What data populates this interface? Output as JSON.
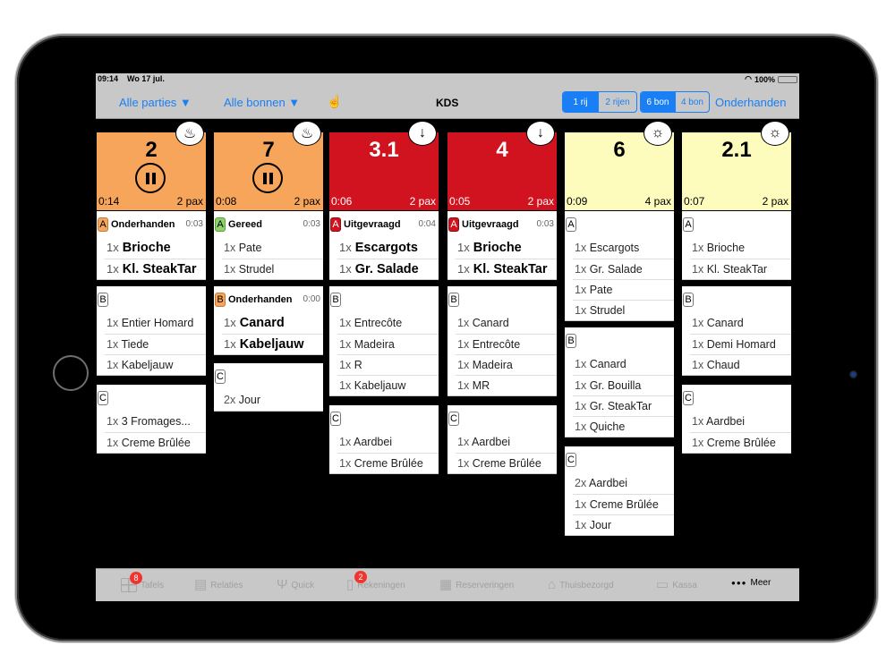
{
  "status_bar": {
    "time": "09:14",
    "date": "Wo 17 jul.",
    "battery": "100%"
  },
  "navbar": {
    "filter_parties": "Alle parties ▼",
    "filter_bonnen": "Alle bonnen ▼",
    "title": "KDS",
    "rows_segment": [
      "1 rij",
      "2 rijen"
    ],
    "rows_selected": "1 rij",
    "bon_segment": [
      "6 bon",
      "4 bon"
    ],
    "bon_selected": "6 bon",
    "right_link": "Onderhanden"
  },
  "colors": {
    "accent": "#1a7ff5",
    "orange": "#f6a55b",
    "red": "#d0131f",
    "yellow": "#fdfcbd",
    "status_green": "#8ed16b"
  },
  "tickets": [
    {
      "table": "2",
      "elapsed": "0:14",
      "pax": "2 pax",
      "color": "orange",
      "paused": true,
      "badge_icon": "steam-icon",
      "badge_glyph": "♨",
      "courses": [
        {
          "letter": "A",
          "status": "Onderhanden",
          "time": "0:03",
          "letter_color": "orange",
          "items": [
            {
              "qty": "1x",
              "name": "Brioche",
              "big": true
            },
            {
              "qty": "1x",
              "name": "Kl. SteakTar",
              "big": true
            }
          ]
        },
        {
          "letter": "B",
          "status": "",
          "time": "",
          "letter_color": "",
          "items": [
            {
              "qty": "1x",
              "name": "Entier Homard"
            },
            {
              "qty": "1x",
              "name": "Tiede"
            },
            {
              "qty": "1x",
              "name": "Kabeljauw"
            }
          ]
        },
        {
          "letter": "C",
          "status": "",
          "time": "",
          "letter_color": "",
          "items": [
            {
              "qty": "1x",
              "name": "3 Fromages..."
            },
            {
              "qty": "1x",
              "name": "Creme Brûlée"
            }
          ]
        }
      ]
    },
    {
      "table": "7",
      "elapsed": "0:08",
      "pax": "2 pax",
      "color": "orange",
      "paused": true,
      "badge_icon": "steam-icon",
      "badge_glyph": "♨",
      "courses": [
        {
          "letter": "A",
          "status": "Gereed",
          "time": "0:03",
          "letter_color": "green",
          "items": [
            {
              "qty": "1x",
              "name": "Pate"
            },
            {
              "qty": "1x",
              "name": "Strudel"
            }
          ]
        },
        {
          "letter": "B",
          "status": "Onderhanden",
          "time": "0:00",
          "letter_color": "orange",
          "items": [
            {
              "qty": "1x",
              "name": "Canard",
              "big": true
            },
            {
              "qty": "1x",
              "name": "Kabeljauw",
              "big": true
            }
          ]
        },
        {
          "letter": "C",
          "status": "",
          "time": "",
          "letter_color": "",
          "items": [
            {
              "qty": "2x",
              "name": "Jour"
            }
          ]
        }
      ]
    },
    {
      "table": "3.1",
      "elapsed": "0:06",
      "pax": "2 pax",
      "color": "red",
      "paused": false,
      "badge_icon": "arrow-down-icon",
      "badge_glyph": "↓",
      "courses": [
        {
          "letter": "A",
          "status": "Uitgevraagd",
          "time": "0:04",
          "letter_color": "red",
          "items": [
            {
              "qty": "1x",
              "name": "Escargots",
              "big": true
            },
            {
              "qty": "1x",
              "name": "Gr. Salade",
              "big": true
            }
          ]
        },
        {
          "letter": "B",
          "status": "",
          "time": "",
          "letter_color": "",
          "items": [
            {
              "qty": "1x",
              "name": "Entrecôte"
            },
            {
              "qty": "1x",
              "name": "Madeira"
            },
            {
              "qty": "1x",
              "name": "R"
            },
            {
              "qty": "1x",
              "name": "Kabeljauw"
            }
          ]
        },
        {
          "letter": "C",
          "status": "",
          "time": "",
          "letter_color": "",
          "items": [
            {
              "qty": "1x",
              "name": "Aardbei"
            },
            {
              "qty": "1x",
              "name": "Creme Brûlée"
            }
          ]
        }
      ]
    },
    {
      "table": "4",
      "elapsed": "0:05",
      "pax": "2 pax",
      "color": "red",
      "paused": false,
      "badge_icon": "arrow-down-icon",
      "badge_glyph": "↓",
      "courses": [
        {
          "letter": "A",
          "status": "Uitgevraagd",
          "time": "0:03",
          "letter_color": "red",
          "items": [
            {
              "qty": "1x",
              "name": "Brioche",
              "big": true
            },
            {
              "qty": "1x",
              "name": "Kl. SteakTar",
              "big": true
            }
          ]
        },
        {
          "letter": "B",
          "status": "",
          "time": "",
          "letter_color": "",
          "items": [
            {
              "qty": "1x",
              "name": "Canard"
            },
            {
              "qty": "1x",
              "name": "Entrecôte"
            },
            {
              "qty": "1x",
              "name": "Madeira"
            },
            {
              "qty": "1x",
              "name": "MR"
            }
          ]
        },
        {
          "letter": "C",
          "status": "",
          "time": "",
          "letter_color": "",
          "items": [
            {
              "qty": "1x",
              "name": "Aardbei"
            },
            {
              "qty": "1x",
              "name": "Creme Brûlée"
            }
          ]
        }
      ]
    },
    {
      "table": "6",
      "elapsed": "0:09",
      "pax": "4 pax",
      "color": "yellow",
      "paused": false,
      "badge_icon": "sun-icon",
      "badge_glyph": "☼",
      "courses": [
        {
          "letter": "A",
          "status": "",
          "time": "",
          "letter_color": "",
          "items": [
            {
              "qty": "1x",
              "name": "Escargots"
            },
            {
              "qty": "1x",
              "name": "Gr. Salade"
            },
            {
              "qty": "1x",
              "name": "Pate"
            },
            {
              "qty": "1x",
              "name": "Strudel"
            }
          ]
        },
        {
          "letter": "B",
          "status": "",
          "time": "",
          "letter_color": "",
          "items": [
            {
              "qty": "1x",
              "name": "Canard"
            },
            {
              "qty": "1x",
              "name": "Gr. Bouilla"
            },
            {
              "qty": "1x",
              "name": "Gr. SteakTar"
            },
            {
              "qty": "1x",
              "name": "Quiche"
            }
          ]
        },
        {
          "letter": "C",
          "status": "",
          "time": "",
          "letter_color": "",
          "items": [
            {
              "qty": "2x",
              "name": "Aardbei"
            },
            {
              "qty": "1x",
              "name": "Creme Brûlée"
            },
            {
              "qty": "1x",
              "name": "Jour"
            }
          ]
        }
      ]
    },
    {
      "table": "2.1",
      "elapsed": "0:07",
      "pax": "2 pax",
      "color": "yellow",
      "paused": false,
      "badge_icon": "sun-icon",
      "badge_glyph": "☼",
      "courses": [
        {
          "letter": "A",
          "status": "",
          "time": "",
          "letter_color": "",
          "items": [
            {
              "qty": "1x",
              "name": "Brioche"
            },
            {
              "qty": "1x",
              "name": "Kl. SteakTar"
            }
          ]
        },
        {
          "letter": "B",
          "status": "",
          "time": "",
          "letter_color": "",
          "items": [
            {
              "qty": "1x",
              "name": "Canard"
            },
            {
              "qty": "1x",
              "name": "Demi Homard"
            },
            {
              "qty": "1x",
              "name": "Chaud"
            }
          ]
        },
        {
          "letter": "C",
          "status": "",
          "time": "",
          "letter_color": "",
          "items": [
            {
              "qty": "1x",
              "name": "Aardbei"
            },
            {
              "qty": "1x",
              "name": "Creme Brûlée"
            }
          ]
        }
      ]
    }
  ],
  "tabbar": [
    {
      "label": "Tafels",
      "icon": "tables-icon",
      "badge": "8"
    },
    {
      "label": "Relaties",
      "icon": "contacts-icon",
      "badge": ""
    },
    {
      "label": "Quick",
      "icon": "fork-knife-icon",
      "badge": ""
    },
    {
      "label": "Rekeningen",
      "icon": "receipt-icon",
      "badge": "2"
    },
    {
      "label": "Reserveringen",
      "icon": "calendar-icon",
      "badge": ""
    },
    {
      "label": "Thuisbezorgd",
      "icon": "home-delivery-icon",
      "badge": ""
    },
    {
      "label": "Kassa",
      "icon": "cash-drawer-icon",
      "badge": ""
    },
    {
      "label": "Meer",
      "icon": "more-dots-icon",
      "badge": "",
      "active": true
    }
  ]
}
